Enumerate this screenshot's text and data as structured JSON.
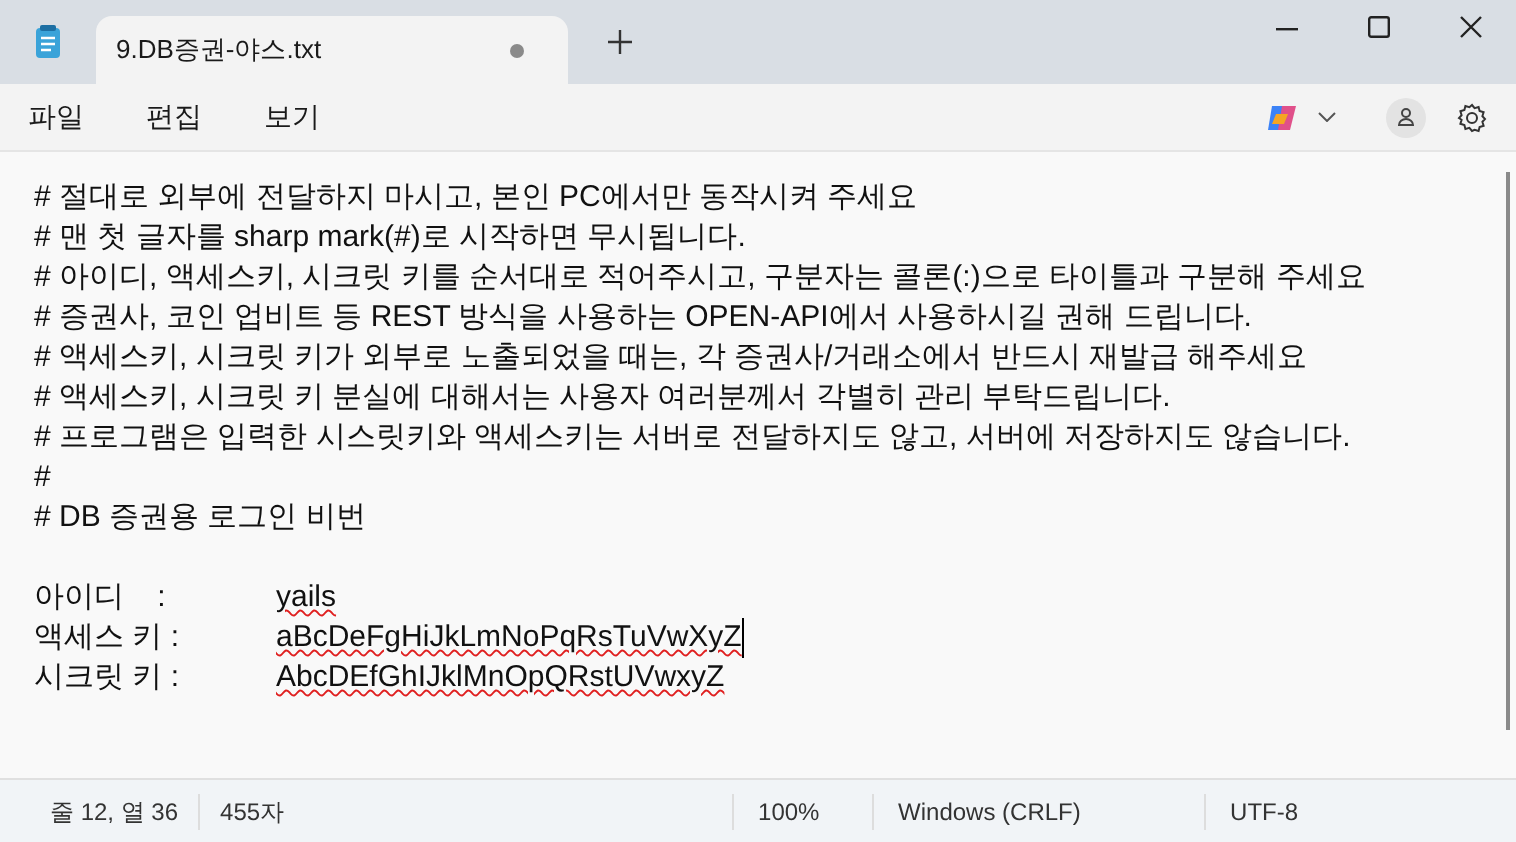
{
  "window": {
    "title": "9.DB증권-야스.txt",
    "unsaved": true
  },
  "menu": [
    "파일",
    "편집",
    "보기"
  ],
  "editor": {
    "lines": [
      {
        "kind": "text",
        "text": "# 절대로 외부에 전달하지 마시고, 본인 PC에서만 동작시켜 주세요"
      },
      {
        "kind": "text",
        "text": "# 맨 첫 글자를 sharp mark(#)로 시작하면 무시됩니다."
      },
      {
        "kind": "text",
        "text": "# 아이디, 액세스키, 시크릿 키를 순서대로 적어주시고, 구분자는 콜론(:)으로 타이틀과 구분해 주세요"
      },
      {
        "kind": "text",
        "text": "# 증권사, 코인 업비트 등 REST 방식을 사용하는 OPEN-API에서 사용하시길 권해 드립니다."
      },
      {
        "kind": "text",
        "text": "# 액세스키, 시크릿 키가 외부로 노출되었을 때는, 각 증권사/거래소에서 반드시 재발급 해주세요"
      },
      {
        "kind": "text",
        "text": "# 액세스키, 시크릿 키 분실에 대해서는 사용자 여러분께서 각별히 관리 부탁드립니다."
      },
      {
        "kind": "text",
        "text": "# 프로그램은 입력한 시스릿키와 액세스키는 서버로 전달하지도 않고, 서버에 저장하지도 않습니다."
      },
      {
        "kind": "text",
        "text": "#"
      },
      {
        "kind": "text",
        "text": "# DB 증권용 로그인 비번"
      },
      {
        "kind": "blank"
      },
      {
        "kind": "field",
        "label": "아이디    :",
        "value": "yails",
        "misspelled": true,
        "cursor": false
      },
      {
        "kind": "field",
        "label": "액세스 키 :",
        "value": "aBcDeFgHiJkLmNoPqRsTuVwXyZ",
        "misspelled": true,
        "cursor": true
      },
      {
        "kind": "field",
        "label": "시크릿 키 :",
        "value": "AbcDEfGhIJklMnOpQRstUVwxyZ",
        "misspelled": true,
        "cursor": false
      }
    ]
  },
  "status_bar": {
    "position": "줄 12, 열 36",
    "characters": "455자",
    "zoom": "100%",
    "line_ending": "Windows (CRLF)",
    "encoding": "UTF-8"
  }
}
